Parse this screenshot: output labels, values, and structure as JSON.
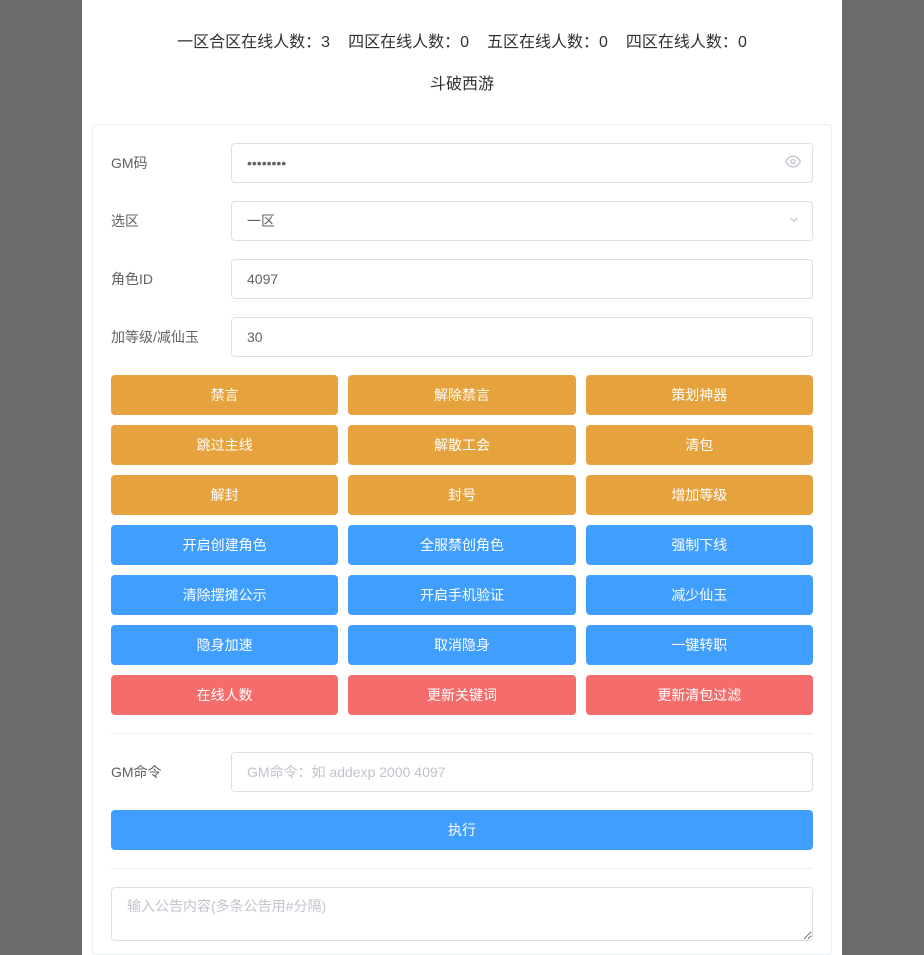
{
  "header": {
    "stats": [
      {
        "label": "一区合区在线人数：",
        "value": "3"
      },
      {
        "label": "四区在线人数：",
        "value": "0"
      },
      {
        "label": "五区在线人数：",
        "value": "0"
      },
      {
        "label": "四区在线人数：",
        "value": "0"
      }
    ],
    "title": "斗破西游"
  },
  "form": {
    "gm_code_label": "GM码",
    "gm_code_value": "••••••••",
    "zone_label": "选区",
    "zone_value": "一区",
    "role_id_label": "角色ID",
    "role_id_value": "4097",
    "level_label": "加等级/减仙玉",
    "level_value": "30",
    "gm_cmd_label": "GM命令",
    "gm_cmd_placeholder": "GM命令：如 addexp 2000 4097",
    "gm_cmd_value": "",
    "execute_label": "执行",
    "announce_placeholder": "输入公告内容(多条公告用#分隔)",
    "announce_value": ""
  },
  "buttons": {
    "orange": [
      [
        "禁言",
        "解除禁言",
        "策划神器"
      ],
      [
        "跳过主线",
        "解散工会",
        "清包"
      ],
      [
        "解封",
        "封号",
        "增加等级"
      ]
    ],
    "blue": [
      [
        "开启创建角色",
        "全服禁创角色",
        "强制下线"
      ],
      [
        "清除摆摊公示",
        "开启手机验证",
        "减少仙玉"
      ],
      [
        "隐身加速",
        "取消隐身",
        "一键转职"
      ]
    ],
    "red": [
      [
        "在线人数",
        "更新关键词",
        "更新清包过滤"
      ]
    ]
  }
}
